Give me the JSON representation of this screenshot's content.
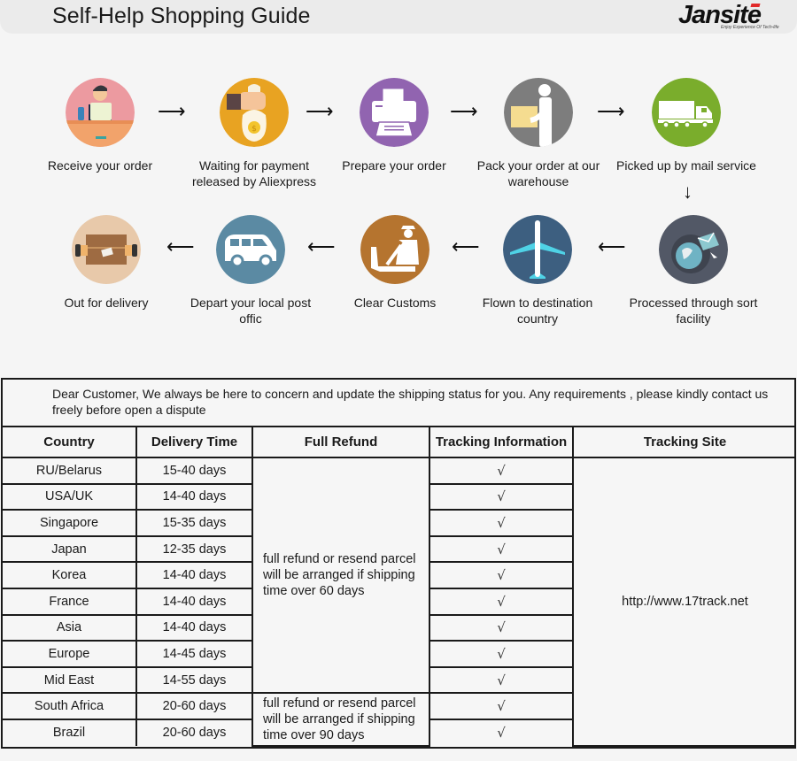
{
  "header": {
    "title": "Self-Help Shopping Guide",
    "logo_name": "Jansite",
    "logo_tagline": "Enjoy Experience Of Tech-life",
    "logo_accent": "#e12a2a"
  },
  "flow": {
    "row1": [
      {
        "label": "Receive your order",
        "icon": "person-laptop-icon",
        "color": "#ec9aa0"
      },
      {
        "label": "Waiting for payment released by Aliexpress",
        "icon": "money-bag-icon",
        "color": "#e8a322"
      },
      {
        "label": "Prepare your order",
        "icon": "printer-icon",
        "color": "#9164b0"
      },
      {
        "label": "Pack your order at our warehouse",
        "icon": "person-box-icon",
        "color": "#7d7d7d"
      },
      {
        "label": "Picked up by mail service",
        "icon": "truck-icon",
        "color": "#7aad2c"
      }
    ],
    "row2": [
      {
        "label": "Out for delivery",
        "icon": "package-hands-icon",
        "color": "#e8c9aa"
      },
      {
        "label": "Depart your local post offic",
        "icon": "van-icon",
        "color": "#5b8aa3"
      },
      {
        "label": "Clear  Customs",
        "icon": "customs-officer-icon",
        "color": "#b5742f"
      },
      {
        "label": "Flown to destination country",
        "icon": "airplane-icon",
        "color": "#3d5f80"
      },
      {
        "label": "Processed through sort facility",
        "icon": "globe-mail-icon",
        "color": "#525866"
      }
    ],
    "arrow_right": "⟶",
    "arrow_left": "⟵",
    "arrow_down": "↓"
  },
  "table": {
    "notice": "Dear Customer, We always be here to concern and update the shipping status for you.  Any requirements , please kindly contact us freely before open a dispute",
    "headers": [
      "Country",
      "Delivery Time",
      "Full Refund",
      "Tracking Information",
      "Tracking Site"
    ],
    "rows": [
      {
        "country": "RU/Belarus",
        "time": "15-40 days",
        "tracking": "√"
      },
      {
        "country": "USA/UK",
        "time": "14-40 days",
        "tracking": "√"
      },
      {
        "country": "Singapore",
        "time": "15-35 days",
        "tracking": "√"
      },
      {
        "country": "Japan",
        "time": "12-35 days",
        "tracking": "√"
      },
      {
        "country": "Korea",
        "time": "14-40 days",
        "tracking": "√"
      },
      {
        "country": "France",
        "time": "14-40 days",
        "tracking": "√"
      },
      {
        "country": "Asia",
        "time": "14-40 days",
        "tracking": "√"
      },
      {
        "country": "Europe",
        "time": "14-45 days",
        "tracking": "√"
      },
      {
        "country": "Mid East",
        "time": "14-55 days",
        "tracking": "√"
      },
      {
        "country": "South Africa",
        "time": "20-60 days",
        "tracking": "√"
      },
      {
        "country": "Brazil",
        "time": "20-60 days",
        "tracking": "√"
      }
    ],
    "refund_60": "full refund or resend parcel will be arranged if shipping time over 60 days",
    "refund_90": "full refund or resend parcel will be arranged if shipping time over 90 days",
    "tracking_site": "http://www.17track.net"
  }
}
